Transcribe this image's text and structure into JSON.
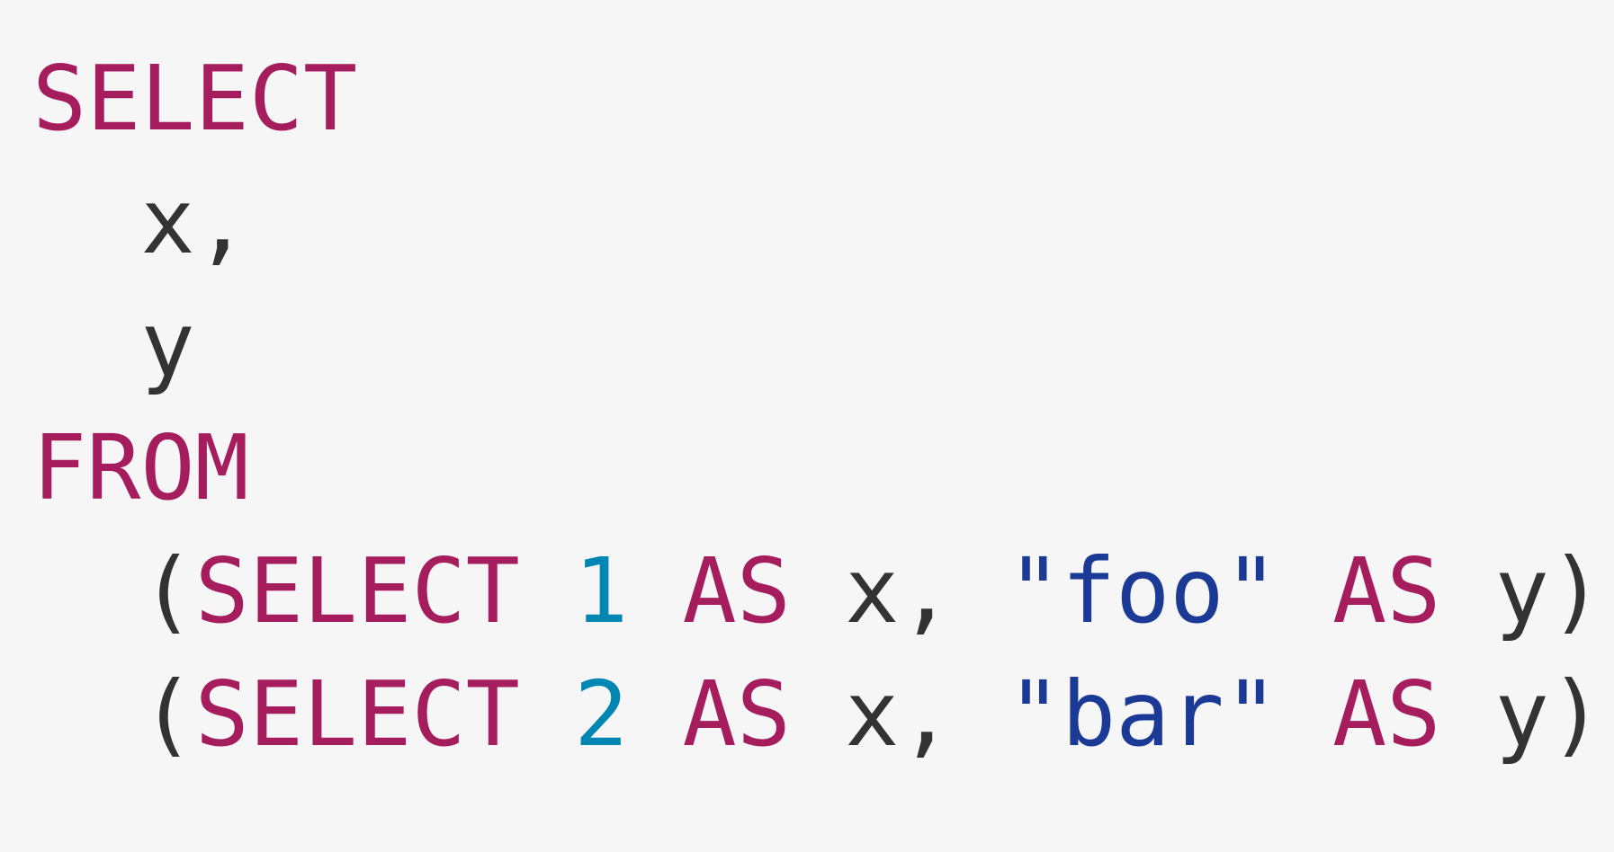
{
  "colors": {
    "background": "#f6f6f6",
    "keyword": "#a61d5e",
    "number": "#0086b3",
    "string": "#1b3a96",
    "plain": "#333333"
  },
  "code": {
    "lines": [
      [
        {
          "text": "SELECT",
          "type": "keyword"
        }
      ],
      [
        {
          "text": "  x,",
          "type": "plain"
        }
      ],
      [
        {
          "text": "  y",
          "type": "plain"
        }
      ],
      [
        {
          "text": "FROM",
          "type": "keyword"
        }
      ],
      [
        {
          "text": "  (",
          "type": "plain"
        },
        {
          "text": "SELECT",
          "type": "keyword"
        },
        {
          "text": " ",
          "type": "plain"
        },
        {
          "text": "1",
          "type": "number"
        },
        {
          "text": " ",
          "type": "plain"
        },
        {
          "text": "AS",
          "type": "keyword"
        },
        {
          "text": " x, ",
          "type": "plain"
        },
        {
          "text": "\"foo\"",
          "type": "string"
        },
        {
          "text": " ",
          "type": "plain"
        },
        {
          "text": "AS",
          "type": "keyword"
        },
        {
          "text": " y),",
          "type": "plain"
        }
      ],
      [
        {
          "text": "  (",
          "type": "plain"
        },
        {
          "text": "SELECT",
          "type": "keyword"
        },
        {
          "text": " ",
          "type": "plain"
        },
        {
          "text": "2",
          "type": "number"
        },
        {
          "text": " ",
          "type": "plain"
        },
        {
          "text": "AS",
          "type": "keyword"
        },
        {
          "text": " x, ",
          "type": "plain"
        },
        {
          "text": "\"bar\"",
          "type": "string"
        },
        {
          "text": " ",
          "type": "plain"
        },
        {
          "text": "AS",
          "type": "keyword"
        },
        {
          "text": " y)",
          "type": "plain"
        }
      ]
    ]
  }
}
